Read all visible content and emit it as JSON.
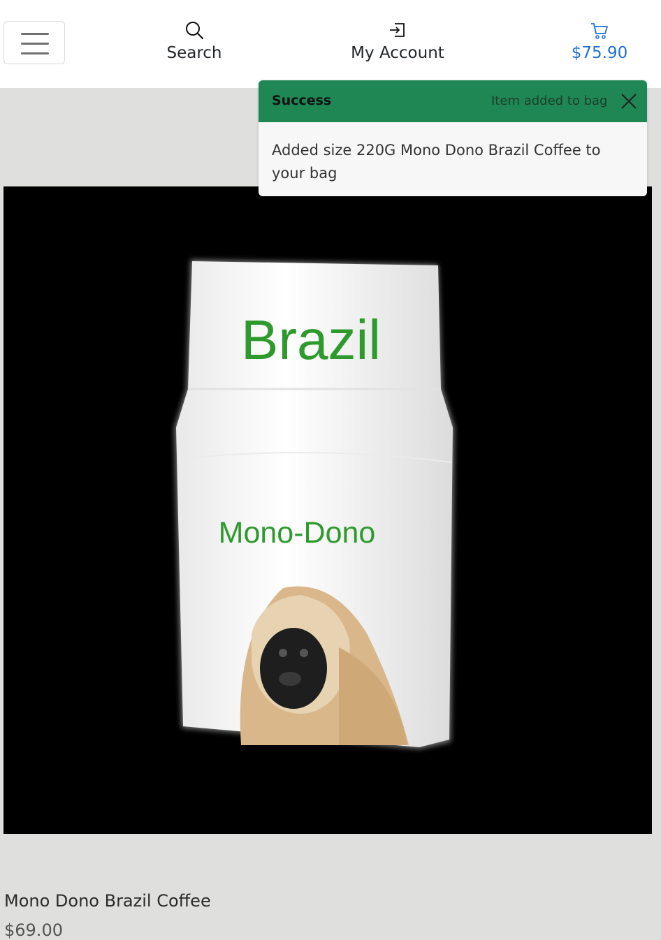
{
  "nav": {
    "search_label": "Search",
    "account_label": "My Account",
    "cart_total": "$75.90",
    "cart_color": "#1f6fd6"
  },
  "toast": {
    "title": "Success",
    "subtitle": "Item added to bag",
    "message": "Added size 220G Mono Dono Brazil Coffee to your bag",
    "header_color": "#1e8754"
  },
  "product": {
    "bag_text_top": "Brazil",
    "bag_text_brand": "Mono-Dono",
    "name": "Mono Dono Brazil Coffee",
    "price": "$69.00"
  },
  "icons": [
    "menu-icon",
    "search-icon",
    "login-icon",
    "cart-icon",
    "close-icon"
  ]
}
